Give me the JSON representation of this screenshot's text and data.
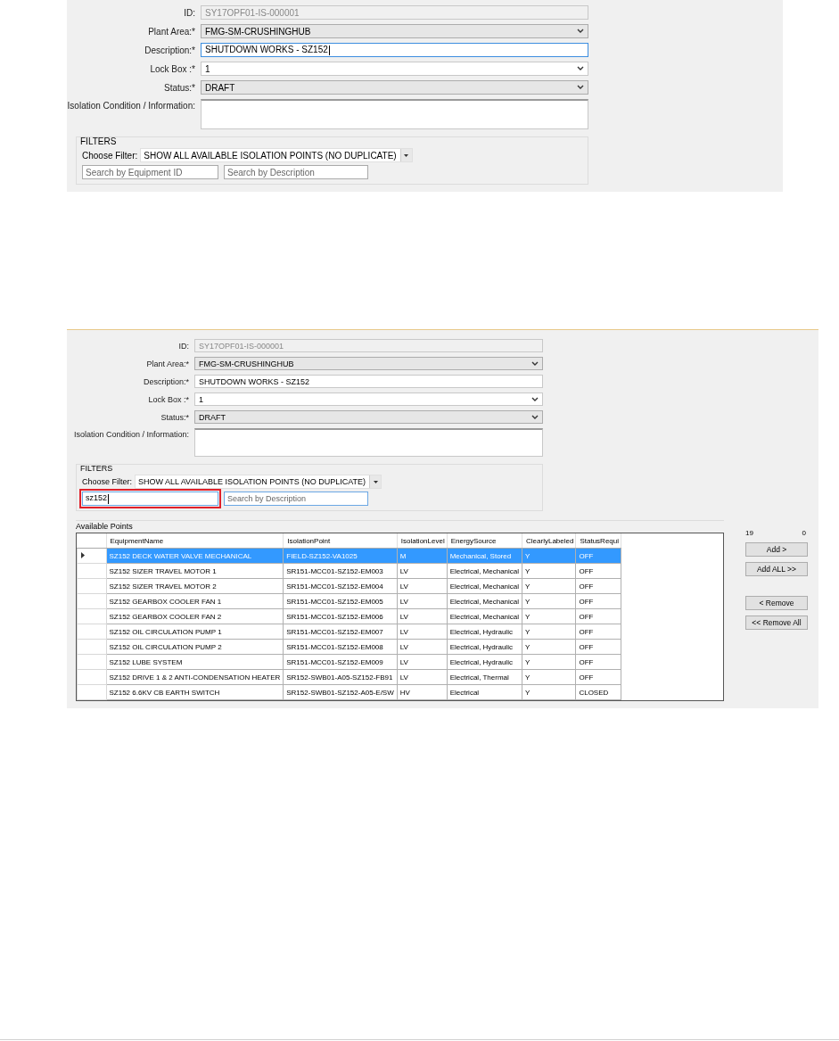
{
  "screenshots": [
    {
      "form": {
        "fields": [
          {
            "label": "ID:",
            "kind": "readonly",
            "value": "SY17OPF01-IS-000001",
            "focused": false
          },
          {
            "label": "Plant Area:*",
            "kind": "dropdown",
            "value": "FMG-SM-CRUSHINGHUB",
            "focused": false
          },
          {
            "label": "Description:*",
            "kind": "text",
            "value": "SHUTDOWN WORKS - SZ152",
            "focused": true
          },
          {
            "label": "Lock Box :*",
            "kind": "combo",
            "value": "1",
            "focused": false
          },
          {
            "label": "Status:*",
            "kind": "dropdown",
            "value": "DRAFT",
            "focused": false
          },
          {
            "label": "Isolation Condition / Information:",
            "kind": "textarea",
            "focused": false
          }
        ]
      },
      "filters": {
        "title": "FILTERS",
        "choose_label": "Choose Filter:",
        "choice": "SHOW ALL AVAILABLE ISOLATION POINTS (NO DUPLICATE)",
        "searches": [
          {
            "placeholder": "Search by Equipment ID",
            "focused": false,
            "highlighted": false
          },
          {
            "placeholder": "Search by Description",
            "focused": false,
            "highlighted": false
          }
        ]
      }
    },
    {
      "form": {
        "fields": [
          {
            "label": "ID:",
            "kind": "readonly",
            "value": "SY17OPF01-IS-000001",
            "focused": false
          },
          {
            "label": "Plant Area:*",
            "kind": "dropdown",
            "value": "FMG-SM-CRUSHINGHUB",
            "focused": false
          },
          {
            "label": "Description:*",
            "kind": "text",
            "value": "SHUTDOWN WORKS - SZ152",
            "focused": false
          },
          {
            "label": "Lock Box :*",
            "kind": "combo",
            "value": "1",
            "focused": false
          },
          {
            "label": "Status:*",
            "kind": "dropdown",
            "value": "DRAFT",
            "focused": false
          },
          {
            "label": "Isolation Condition / Information:",
            "kind": "textarea",
            "focused": false
          }
        ]
      },
      "filters": {
        "title": "FILTERS",
        "choose_label": "Choose Filter:",
        "choice": "SHOW ALL AVAILABLE ISOLATION POINTS (NO DUPLICATE)",
        "searches": [
          {
            "value": "sz152",
            "focused": true,
            "highlighted": true
          },
          {
            "placeholder": "Search by Description",
            "focused": true,
            "highlighted": false
          }
        ]
      },
      "available_points": {
        "title": "Available Points",
        "columns": [
          "EquipmentName",
          "IsolationPoint",
          "IsolationLevel",
          "EnergySource",
          "ClearlyLabeled",
          "StatusRequi"
        ],
        "rows": [
          {
            "selected": true,
            "cells": [
              "SZ152 DECK WATER VALVE MECHANICAL",
              "FIELD-SZ152-VA1025",
              "M",
              "Mechanical, Stored",
              "Y",
              "OFF"
            ]
          },
          {
            "selected": false,
            "cells": [
              "SZ152 SIZER TRAVEL MOTOR 1",
              "SR151-MCC01-SZ152-EM003",
              "LV",
              "Electrical, Mechanical",
              "Y",
              "OFF"
            ]
          },
          {
            "selected": false,
            "cells": [
              "SZ152 SIZER TRAVEL MOTOR 2",
              "SR151-MCC01-SZ152-EM004",
              "LV",
              "Electrical, Mechanical",
              "Y",
              "OFF"
            ]
          },
          {
            "selected": false,
            "cells": [
              "SZ152 GEARBOX COOLER FAN 1",
              "SR151-MCC01-SZ152-EM005",
              "LV",
              "Electrical, Mechanical",
              "Y",
              "OFF"
            ]
          },
          {
            "selected": false,
            "cells": [
              "SZ152 GEARBOX COOLER FAN 2",
              "SR151-MCC01-SZ152-EM006",
              "LV",
              "Electrical, Mechanical",
              "Y",
              "OFF"
            ]
          },
          {
            "selected": false,
            "cells": [
              "SZ152 OIL CIRCULATION PUMP 1",
              "SR151-MCC01-SZ152-EM007",
              "LV",
              "Electrical, Hydraulic",
              "Y",
              "OFF"
            ]
          },
          {
            "selected": false,
            "cells": [
              "SZ152 OIL CIRCULATION PUMP 2",
              "SR151-MCC01-SZ152-EM008",
              "LV",
              "Electrical, Hydraulic",
              "Y",
              "OFF"
            ]
          },
          {
            "selected": false,
            "cells": [
              "SZ152 LUBE SYSTEM",
              "SR151-MCC01-SZ152-EM009",
              "LV",
              "Electrical, Hydraulic",
              "Y",
              "OFF"
            ]
          },
          {
            "selected": false,
            "cells": [
              "SZ152 DRIVE 1 & 2 ANTI-CONDENSATION HEATER",
              "SR152-SWB01-A05-SZ152-FB91",
              "LV",
              "Electrical, Thermal",
              "Y",
              "OFF"
            ]
          },
          {
            "selected": false,
            "cells": [
              "SZ152 6.6KV CB EARTH SWITCH",
              "SR152-SWB01-SZ152-A05-E/SW",
              "HV",
              "Electrical",
              "Y",
              "CLOSED"
            ]
          }
        ]
      },
      "counts": [
        "19",
        "0"
      ],
      "button_groups": [
        [
          "Add >",
          "Add ALL >>"
        ],
        [
          "< Remove",
          "<< Remove All"
        ]
      ]
    }
  ]
}
